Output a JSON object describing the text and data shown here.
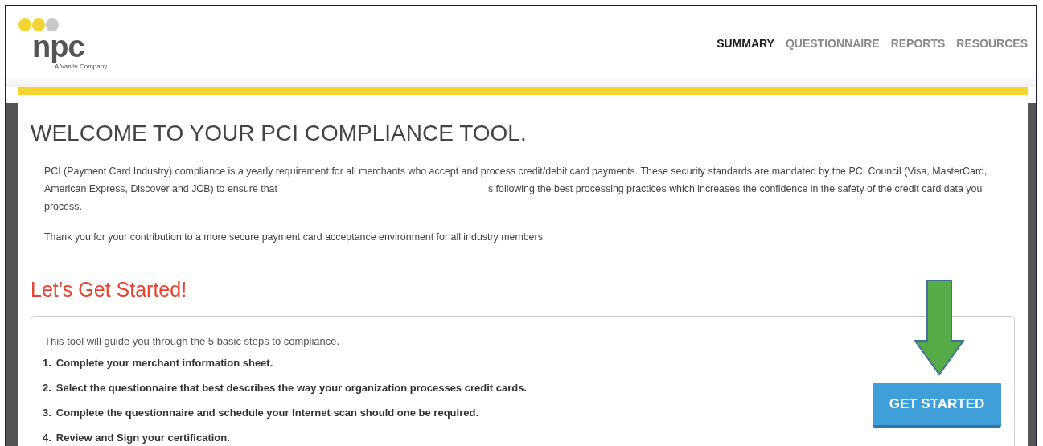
{
  "header": {
    "logo": {
      "wordmark": "npc",
      "tagline": "A Vantiv Company"
    },
    "nav": [
      {
        "label": "SUMMARY",
        "selected": true
      },
      {
        "label": "QUESTIONNAIRE",
        "selected": false
      },
      {
        "label": "REPORTS",
        "selected": false
      },
      {
        "label": "RESOURCES",
        "selected": false
      }
    ]
  },
  "main": {
    "title": "WELCOME TO YOUR PCI COMPLIANCE TOOL.",
    "intro_before_gap": "PCI (Payment Card Industry) compliance is a yearly requirement for all merchants who accept and process credit/debit card payments. These security standards are mandated by the PCI Council (Visa, MasterCard, American Express, Discover and JCB) to ensure that",
    "intro_after_gap": "s following the best processing practices which increases the confidence in the safety of the credit card data you process.",
    "thanks": "Thank you for your contribution to a more secure payment card acceptance environment for all industry members.",
    "section_title": "Let’s Get Started!",
    "steps_intro": "This tool will guide you through the 5 basic steps to compliance.",
    "steps": [
      {
        "number": "1.",
        "text": "Complete your merchant information sheet."
      },
      {
        "number": "2.",
        "text": "Select the questionnaire that best describes the way your organization processes credit cards."
      },
      {
        "number": "3.",
        "text": "Complete the questionnaire and schedule your Internet scan should one be required."
      },
      {
        "number": "4.",
        "text": "Review and Sign your certification."
      }
    ],
    "button": "GET STARTED"
  }
}
